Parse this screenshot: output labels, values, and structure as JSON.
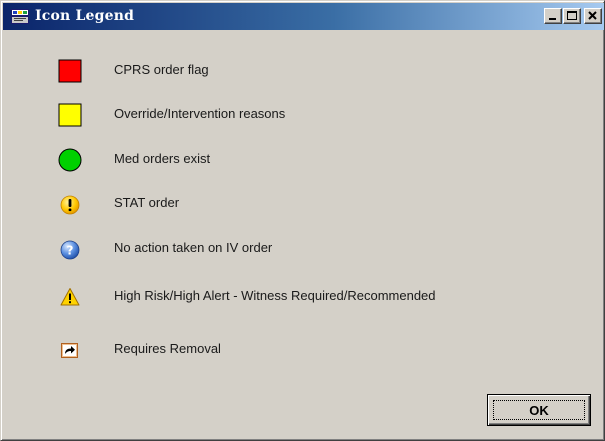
{
  "window": {
    "title": "Icon Legend",
    "title_icon": "app-icon",
    "controls": [
      "minimize-icon",
      "maximize-icon",
      "close-icon"
    ]
  },
  "legend": {
    "items": [
      {
        "icon": "red-square-icon",
        "color": "#ff0000",
        "label": "CPRS order flag"
      },
      {
        "icon": "yellow-square-icon",
        "color": "#ffff00",
        "label": "Override/Intervention reasons"
      },
      {
        "icon": "green-circle-icon",
        "color": "#00d000",
        "label": "Med orders exist"
      },
      {
        "icon": "exclamation-icon",
        "color": "#ffcc00",
        "label": "STAT order"
      },
      {
        "icon": "question-icon",
        "color": "#3b74d4",
        "label": "No action taken on IV order"
      },
      {
        "icon": "warning-triangle-icon",
        "color": "#ffd200",
        "label": "High Risk/High Alert - Witness Required/Recommended"
      },
      {
        "icon": "removal-arrow-icon",
        "color": "#e8a060",
        "label": "Requires Removal"
      }
    ]
  },
  "footer": {
    "ok_label": "OK"
  }
}
